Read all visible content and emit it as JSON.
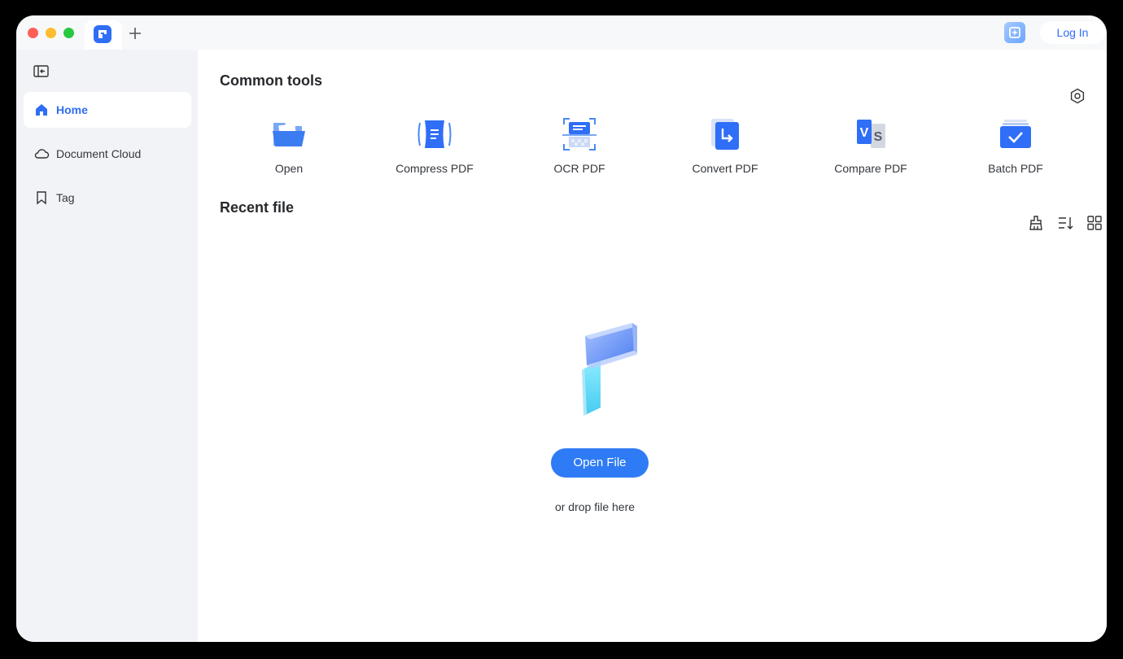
{
  "titlebar": {
    "new_tab_icon": "plus-icon",
    "login_label": "Log In",
    "app_logo_icon": "pdf-logo-icon",
    "ai_icon": "ai-assistant-icon"
  },
  "sidebar": {
    "collapse_icon": "sidebar-collapse-icon",
    "items": [
      {
        "label": "Home",
        "icon": "home-icon",
        "active": true
      },
      {
        "label": "Document Cloud",
        "icon": "cloud-icon",
        "active": false
      },
      {
        "label": "Tag",
        "icon": "bookmark-icon",
        "active": false
      }
    ]
  },
  "main": {
    "common_tools_title": "Common tools",
    "settings_icon": "settings-icon",
    "tools": [
      {
        "label": "Open",
        "icon": "folder-open-icon"
      },
      {
        "label": "Compress PDF",
        "icon": "compress-icon"
      },
      {
        "label": "OCR PDF",
        "icon": "ocr-scan-icon"
      },
      {
        "label": "Convert PDF",
        "icon": "convert-icon"
      },
      {
        "label": "Compare PDF",
        "icon": "compare-icon"
      },
      {
        "label": "Batch PDF",
        "icon": "batch-icon"
      }
    ],
    "recent_title": "Recent file",
    "view_controls": [
      "clean-icon",
      "sort-icon",
      "grid-view-icon"
    ],
    "open_file_label": "Open File",
    "drop_hint": "or drop file here"
  },
  "colors": {
    "accent": "#2f6ef6",
    "sidebar_bg": "#f2f3f7",
    "button_bg": "#2f7bf5"
  }
}
